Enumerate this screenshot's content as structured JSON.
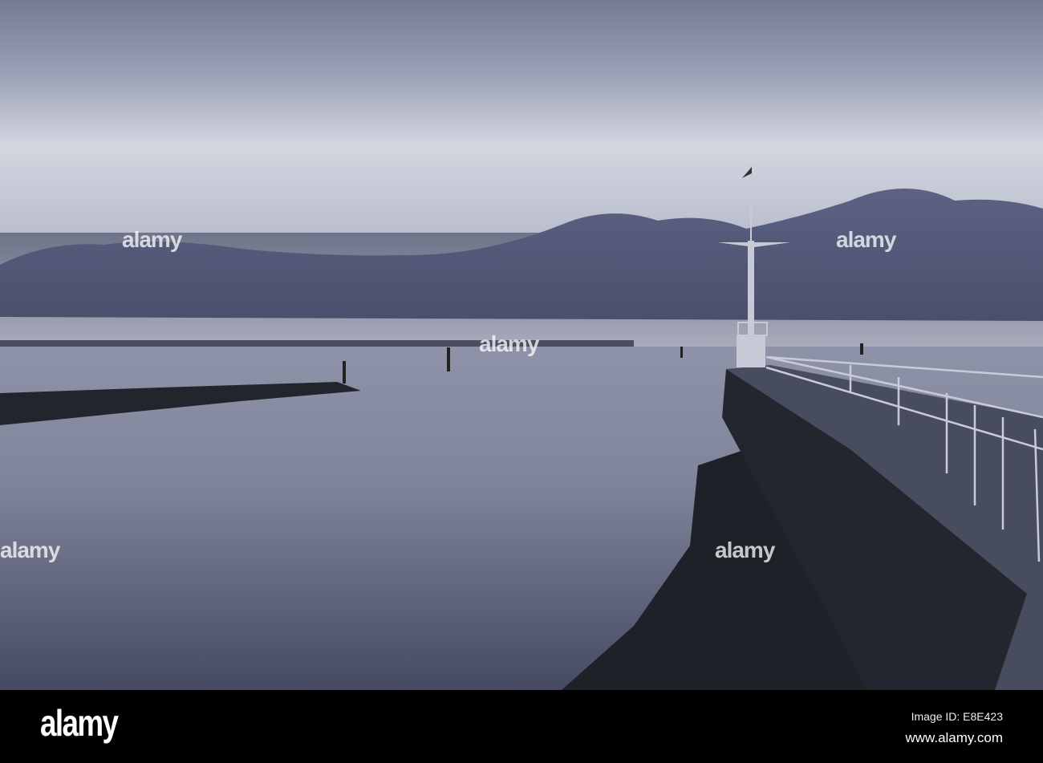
{
  "watermark": {
    "logo": "alamy",
    "image_id": "Image ID: E8E423",
    "website": "www.alamy.com",
    "overlay_text": "alamy"
  },
  "scene": {
    "subject": "harbour pier with light tower at dusk"
  },
  "colors": {
    "sky_top": "#7b8298",
    "sky_light": "#d3d6e0",
    "cloud_bank": "#4b5272",
    "water": "#8d92a8",
    "pier": "#23262f",
    "bar": "#000000"
  }
}
